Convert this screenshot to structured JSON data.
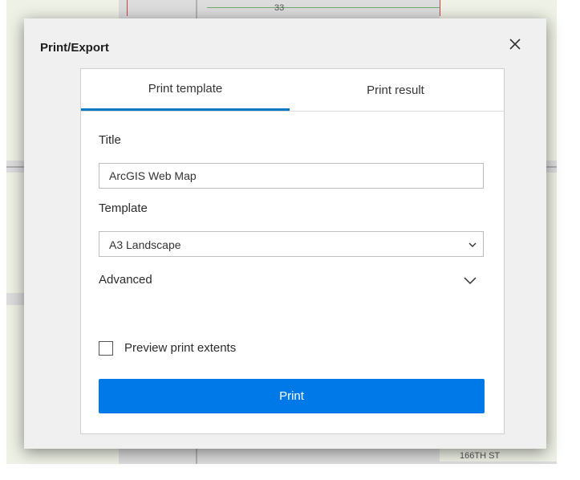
{
  "dialog": {
    "title": "Print/Export",
    "close_icon": "close-icon"
  },
  "tabs": [
    {
      "label": "Print template",
      "active": true
    },
    {
      "label": "Print result",
      "active": false
    }
  ],
  "form": {
    "title_label": "Title",
    "title_value": "ArcGIS Web Map",
    "template_label": "Template",
    "template_value": "A3 Landscape",
    "advanced_label": "Advanced",
    "preview_label": "Preview print extents",
    "preview_checked": false,
    "print_label": "Print"
  },
  "map_labels": {
    "top_number": "33",
    "bottom_right_street": "166TH ST"
  },
  "colors": {
    "accent": "#0079c1",
    "button": "#0079e8",
    "dialog_bg": "#f0f0f0"
  }
}
